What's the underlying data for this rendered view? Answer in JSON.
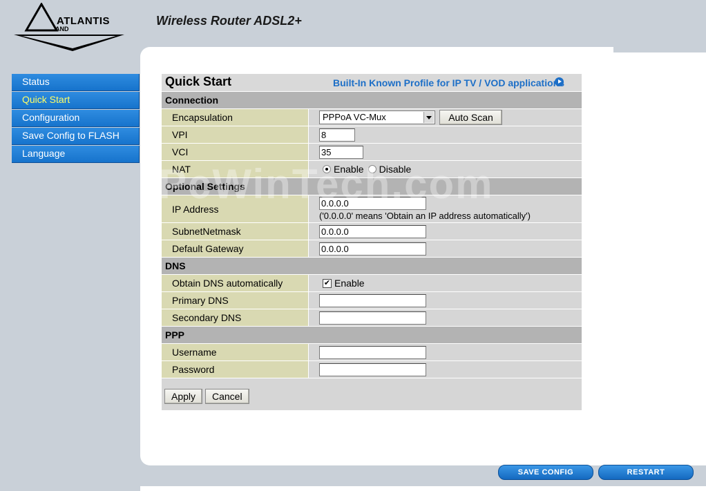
{
  "header": {
    "logo_text": "ATLANTIS",
    "logo_sub": "AND",
    "product_title": "Wireless Router ADSL2+"
  },
  "sidebar": {
    "items": [
      {
        "label": "Status"
      },
      {
        "label": "Quick Start"
      },
      {
        "label": "Configuration"
      },
      {
        "label": "Save Config to FLASH"
      },
      {
        "label": "Language"
      }
    ],
    "active": "Quick Start"
  },
  "page": {
    "title": "Quick Start",
    "profile_link": "Built-In Known Profile for IP TV / VOD applications"
  },
  "connection": {
    "section": "Connection",
    "encapsulation_label": "Encapsulation",
    "encapsulation_value": "PPPoA VC-Mux",
    "auto_scan": "Auto Scan",
    "vpi_label": "VPI",
    "vpi_value": "8",
    "vci_label": "VCI",
    "vci_value": "35",
    "nat_label": "NAT",
    "nat_enable": "Enable",
    "nat_disable": "Disable",
    "nat_selected": "Enable"
  },
  "optional": {
    "section": "Optional Settings",
    "ip_label": "IP Address",
    "ip_value": "0.0.0.0",
    "ip_hint": "('0.0.0.0' means 'Obtain an IP address automatically')",
    "subnet_label": "SubnetNetmask",
    "subnet_value": "0.0.0.0",
    "gateway_label": "Default Gateway",
    "gateway_value": "0.0.0.0"
  },
  "dns": {
    "section": "DNS",
    "auto_label": "Obtain DNS automatically",
    "auto_checkbox": "Enable",
    "auto_checked": true,
    "primary_label": "Primary DNS",
    "primary_value": "",
    "secondary_label": "Secondary DNS",
    "secondary_value": ""
  },
  "ppp": {
    "section": "PPP",
    "username_label": "Username",
    "username_value": "",
    "password_label": "Password",
    "password_value": ""
  },
  "actions": {
    "apply": "Apply",
    "cancel": "Cancel"
  },
  "footer": {
    "save_config": "SAVE CONFIG",
    "restart": "RESTART"
  },
  "watermark": "PcWinTech.com",
  "colors": {
    "background": "#c9d0d8",
    "sidebar_blue": "#1673cc",
    "active_text": "#ffff66",
    "label_cell": "#d9d9b2",
    "link_blue": "#1d6fc7"
  }
}
